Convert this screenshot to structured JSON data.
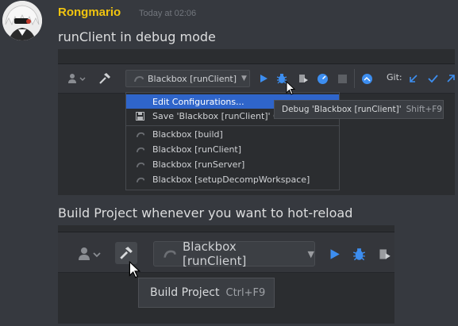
{
  "message": {
    "username": "Rongmario",
    "timestamp": "Today at 02:06",
    "username_color": "#f1c40f",
    "line1": "runClient in debug mode",
    "line2": "Build Project whenever you want to hot-reload"
  },
  "screenshot1": {
    "run_config": "Blackbox [runClient]",
    "git_label": "Git:",
    "menu_items": [
      "Edit Configurations...",
      "Save 'Blackbox [runClient]' Co",
      "Blackbox [build]",
      "Blackbox [runClient]",
      "Blackbox [runServer]",
      "Blackbox [setupDecompWorkspace]"
    ],
    "tooltip_text": "Debug 'Blackbox [runClient]'",
    "tooltip_shortcut": "Shift+F9"
  },
  "screenshot2": {
    "run_config": "Blackbox [runClient]",
    "tooltip_text": "Build Project",
    "tooltip_shortcut": "Ctrl+F9"
  },
  "colors": {
    "run_green": "#4ec94e",
    "run_blue": "#3d8ef0",
    "debug_blue": "#3d8ef0",
    "selection": "#2f65ca"
  }
}
